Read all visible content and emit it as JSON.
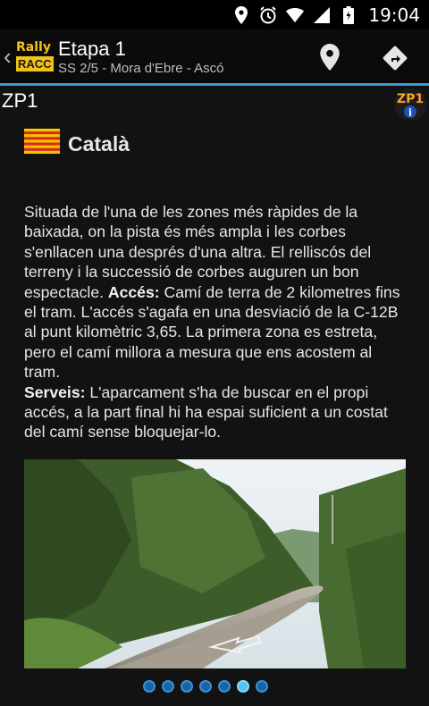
{
  "status_bar": {
    "time": "19:04",
    "icons": [
      "location-icon",
      "alarm-icon",
      "wifi-icon",
      "signal-icon",
      "battery-icon"
    ]
  },
  "app_bar": {
    "logo": {
      "line1": "Rally",
      "line2": "RACC"
    },
    "title": "Etapa 1",
    "subtitle": "SS 2/5 - Mora d'Ebre - Ascó",
    "actions": [
      "location-pin-icon",
      "directions-icon"
    ],
    "accent_color": "#3a9bd5"
  },
  "content": {
    "zone_title": "ZP1",
    "badge": {
      "text": "ZP1",
      "info": "i"
    },
    "language": "Català",
    "description": {
      "p1": "Situada de l'una de les zones més ràpides de la baixada, on la pista és més ampla i les corbes s'enllacen una després d'una altra. El relliscós del terreny i la successió de corbes auguren un bon espectacle.",
      "acces_label": "Accés:",
      "acces_text": "Camí de terra de 2 kilometres fins el tram. L'accés s'agafa en una desviació de la C-12B al punt kilomètric 3,65. La primera zona es estreta, pero el camí millora a mesura que ens acostem al tram.",
      "serveis_label": "Serveis:",
      "serveis_text": "L'aparcament s'ha de buscar en el propi accés, a la part final hi ha espai suficient a un costat del camí sense bloquejar-lo."
    },
    "pager": {
      "count": 7,
      "active_index": 5
    }
  }
}
